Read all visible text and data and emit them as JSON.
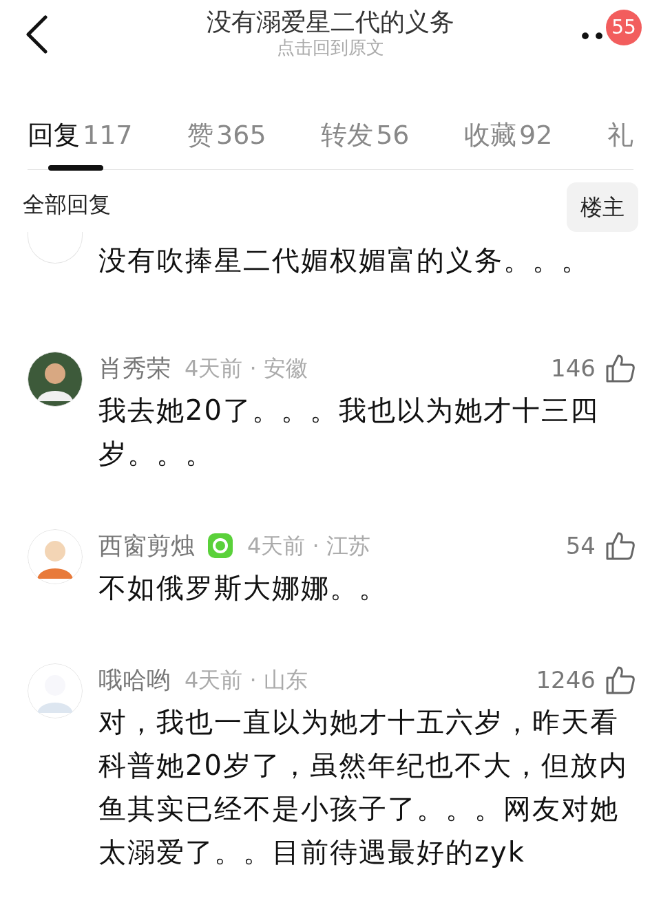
{
  "header": {
    "title": "没有溺爱星二代的义务",
    "subtitle": "点击回到原文",
    "more": "••",
    "badge": "55"
  },
  "tabs": [
    {
      "label": "回复",
      "count": "117",
      "selected": true
    },
    {
      "label": "赞",
      "count": "365",
      "selected": false
    },
    {
      "label": "转发",
      "count": "56",
      "selected": false
    },
    {
      "label": "收藏",
      "count": "92",
      "selected": false
    },
    {
      "label": "礼",
      "selected": false
    }
  ],
  "filter": {
    "label": "全部回复",
    "button": "楼主"
  },
  "comments": [
    {
      "kind": "partial",
      "text": "没有吹捧星二代媚权媚富的义务。。。"
    },
    {
      "kind": "full",
      "name": "肖秀荣",
      "meta": "4天前 · 安徽",
      "likes": "146",
      "text": "我去她20了。。。我也以为她才十三四岁。。。"
    },
    {
      "kind": "full",
      "name": "西窗剪烛",
      "verified": true,
      "meta": "4天前 · 江苏",
      "likes": "54",
      "text": "不如俄罗斯大娜娜。。"
    },
    {
      "kind": "full",
      "name": "哦哈哟",
      "meta": "4天前 · 山东",
      "likes": "1246",
      "text": "对，我也一直以为她才十五六岁，昨天看科普她20岁了，虽然年纪也不大，但放内鱼其实已经不是小孩子了。。。网友对她太溺爱了。。目前待遇最好的zyk"
    }
  ]
}
